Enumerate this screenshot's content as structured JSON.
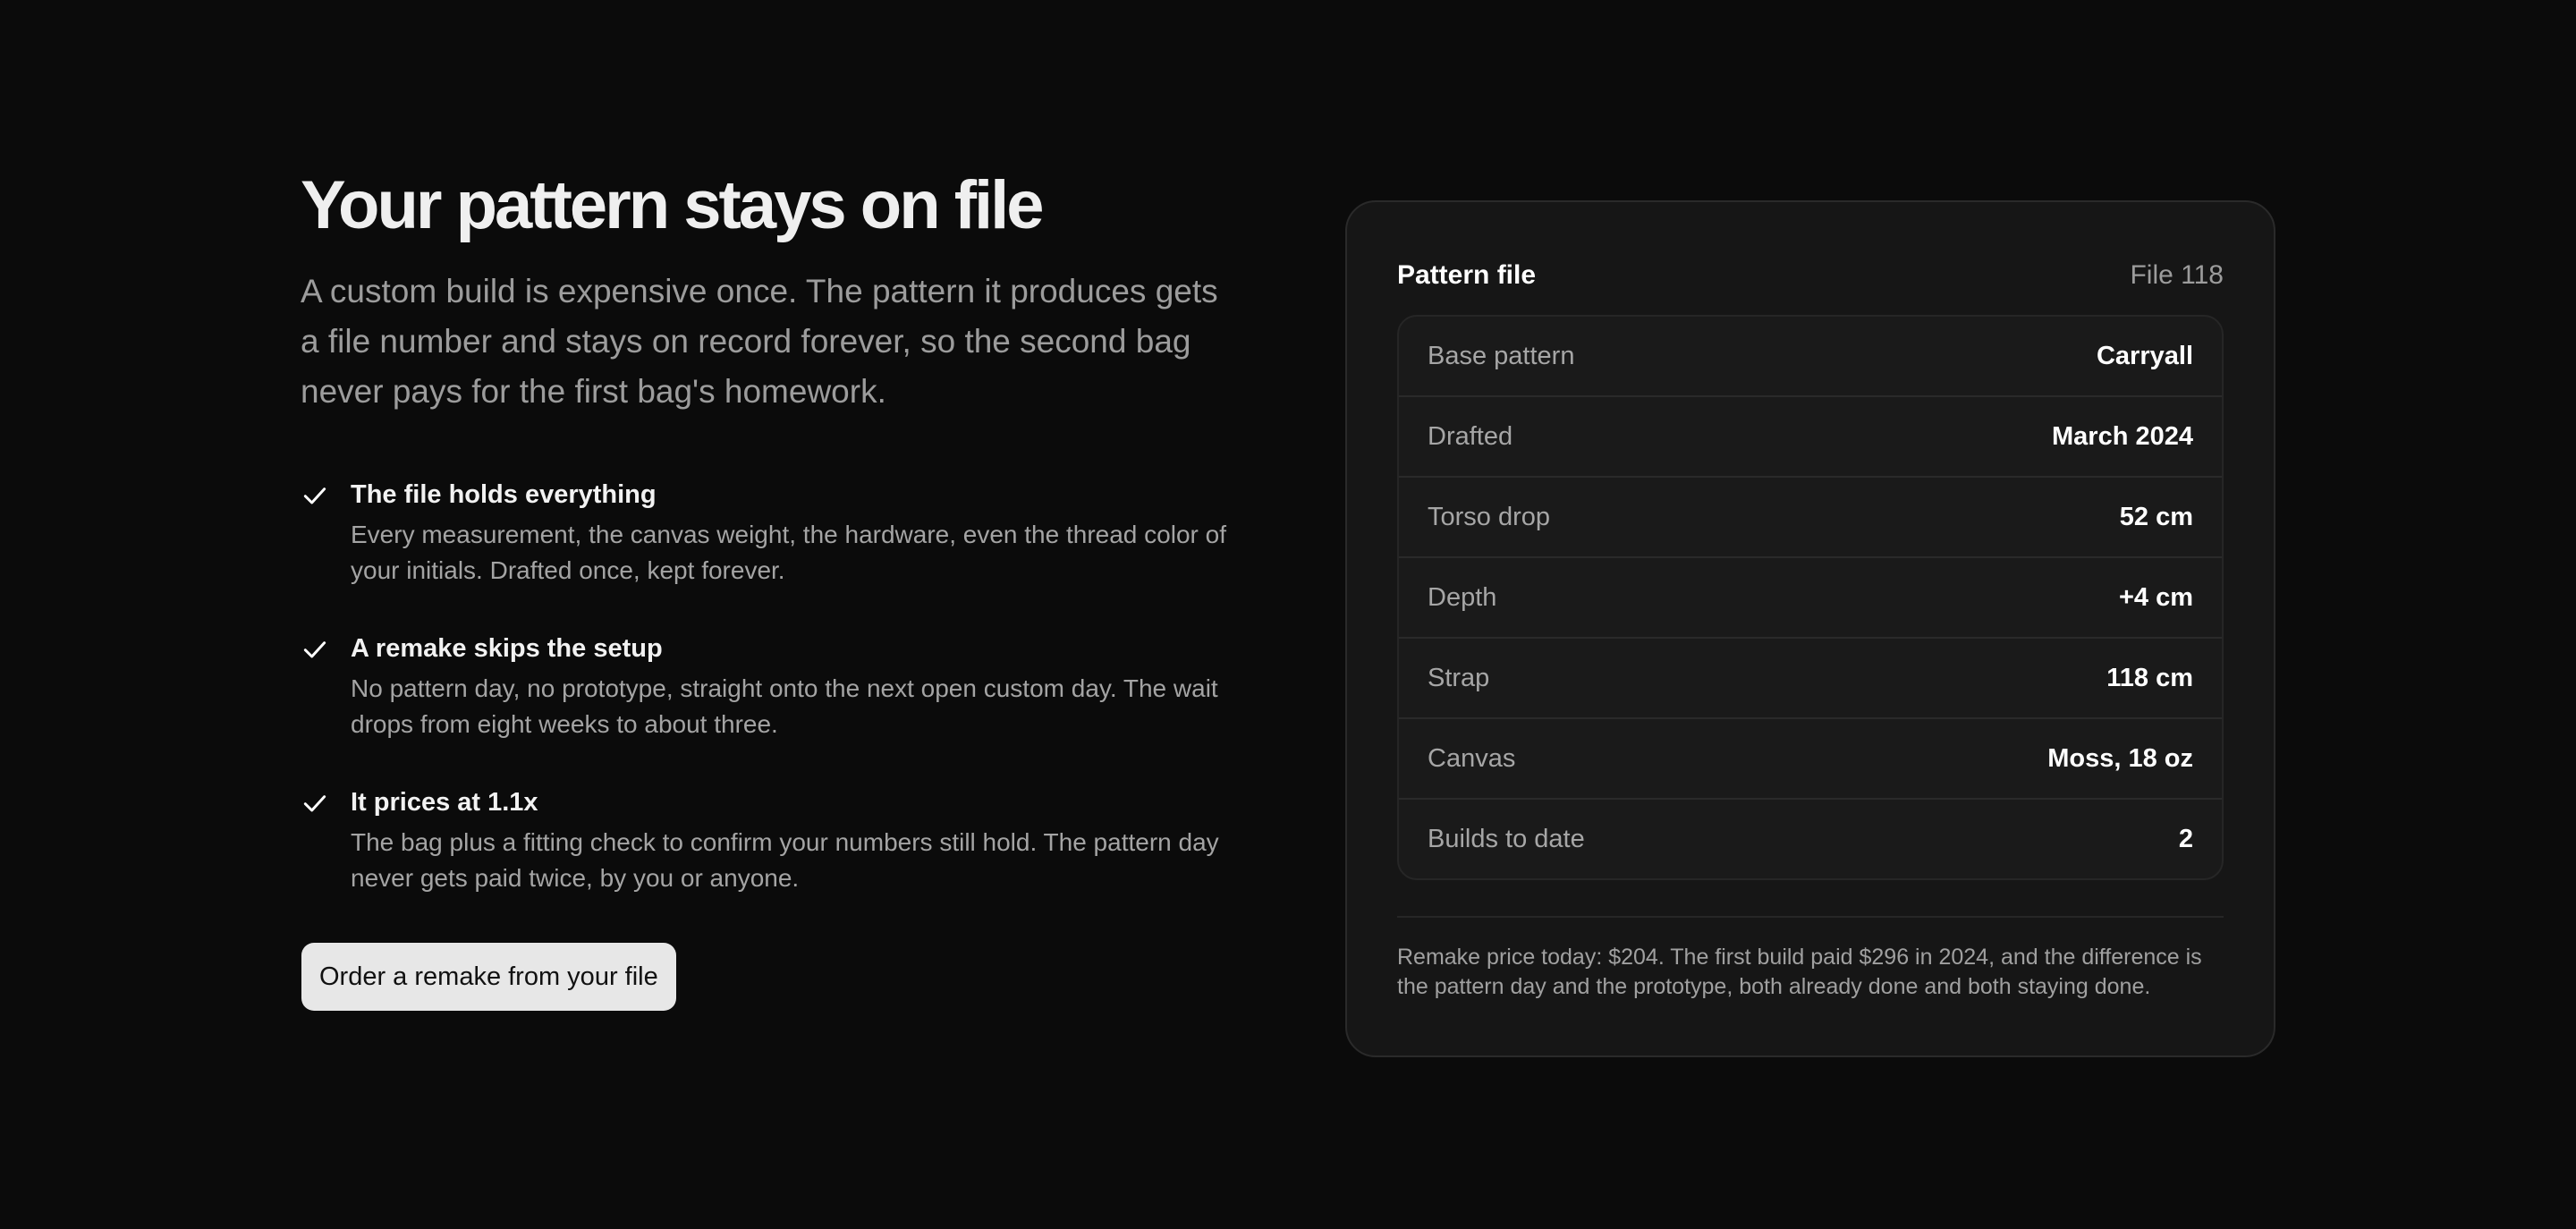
{
  "hero": {
    "title": "Your pattern stays on file",
    "lead": "A custom build is expensive once. The pattern it produces gets a file number and stays on record forever, so the second bag never pays for the first bag's homework."
  },
  "features": [
    {
      "icon": "check-icon",
      "title": "The file holds everything",
      "description": "Every measurement, the canvas weight, the hardware, even the thread color of your initials. Drafted once, kept forever."
    },
    {
      "icon": "check-icon",
      "title": "A remake skips the setup",
      "description": "No pattern day, no prototype, straight onto the next open custom day. The wait drops from eight weeks to about three."
    },
    {
      "icon": "check-icon",
      "title": "It prices at 1.1x",
      "description": "The bag plus a fitting check to confirm your numbers still hold. The pattern day never gets paid twice, by you or anyone."
    }
  ],
  "cta": {
    "label": "Order a remake from your file"
  },
  "card": {
    "title": "Pattern file",
    "file_label": "File 118",
    "rows": [
      {
        "label": "Base pattern",
        "value": "Carryall"
      },
      {
        "label": "Drafted",
        "value": "March 2024"
      },
      {
        "label": "Torso drop",
        "value": "52 cm"
      },
      {
        "label": "Depth",
        "value": "+4 cm"
      },
      {
        "label": "Strap",
        "value": "118 cm"
      },
      {
        "label": "Canvas",
        "value": "Moss, 18 oz"
      },
      {
        "label": "Builds to date",
        "value": "2"
      }
    ],
    "note": "Remake price today: $204. The first build paid $296 in 2024, and the difference is the pattern day and the prototype, both already done and both staying done."
  },
  "colors": {
    "background": "#0b0b0b",
    "card": "#161616",
    "button": "#e7e7e7",
    "muted_text": "#9c9c9c"
  }
}
